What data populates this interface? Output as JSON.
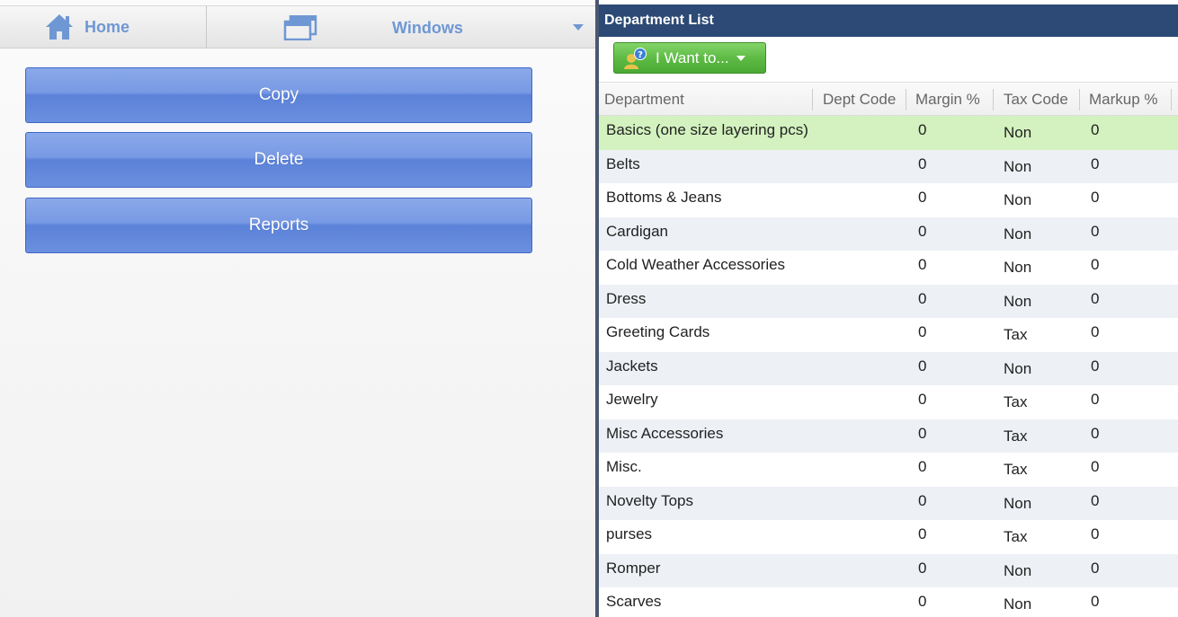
{
  "nav": {
    "home_label": "Home",
    "windows_label": "Windows"
  },
  "actions": {
    "copy_label": "Copy",
    "delete_label": "Delete",
    "reports_label": "Reports"
  },
  "panel": {
    "title": "Department List",
    "i_want_label": "I Want to..."
  },
  "grid": {
    "columns": [
      "Department",
      "Dept Code",
      "Margin %",
      "Tax Code",
      "Markup %"
    ],
    "rows": [
      {
        "department": "Basics (one size layering pcs)",
        "dept_code": "",
        "margin": "0",
        "tax_code": "Non",
        "markup": "0"
      },
      {
        "department": "Belts",
        "dept_code": "",
        "margin": "0",
        "tax_code": "Non",
        "markup": "0"
      },
      {
        "department": "Bottoms & Jeans",
        "dept_code": "",
        "margin": "0",
        "tax_code": "Non",
        "markup": "0"
      },
      {
        "department": "Cardigan",
        "dept_code": "",
        "margin": "0",
        "tax_code": "Non",
        "markup": "0"
      },
      {
        "department": "Cold Weather Accessories",
        "dept_code": "",
        "margin": "0",
        "tax_code": "Non",
        "markup": "0"
      },
      {
        "department": "Dress",
        "dept_code": "",
        "margin": "0",
        "tax_code": "Non",
        "markup": "0"
      },
      {
        "department": "Greeting Cards",
        "dept_code": "",
        "margin": "0",
        "tax_code": "Tax",
        "markup": "0"
      },
      {
        "department": "Jackets",
        "dept_code": "",
        "margin": "0",
        "tax_code": "Non",
        "markup": "0"
      },
      {
        "department": "Jewelry",
        "dept_code": "",
        "margin": "0",
        "tax_code": "Tax",
        "markup": "0"
      },
      {
        "department": "Misc Accessories",
        "dept_code": "",
        "margin": "0",
        "tax_code": "Tax",
        "markup": "0"
      },
      {
        "department": "Misc.",
        "dept_code": "",
        "margin": "0",
        "tax_code": "Tax",
        "markup": "0"
      },
      {
        "department": "Novelty Tops",
        "dept_code": "",
        "margin": "0",
        "tax_code": "Non",
        "markup": "0"
      },
      {
        "department": "purses",
        "dept_code": "",
        "margin": "0",
        "tax_code": "Tax",
        "markup": "0"
      },
      {
        "department": "Romper",
        "dept_code": "",
        "margin": "0",
        "tax_code": "Non",
        "markup": "0"
      },
      {
        "department": "Scarves",
        "dept_code": "",
        "margin": "0",
        "tax_code": "Non",
        "markup": "0"
      }
    ]
  },
  "colors": {
    "header_bg": "#2c4a75",
    "selected_row": "#d3f2bf",
    "action_button": "#6b8fe0",
    "i_want_button": "#5ebb45",
    "nav_text": "#6f97d4"
  }
}
